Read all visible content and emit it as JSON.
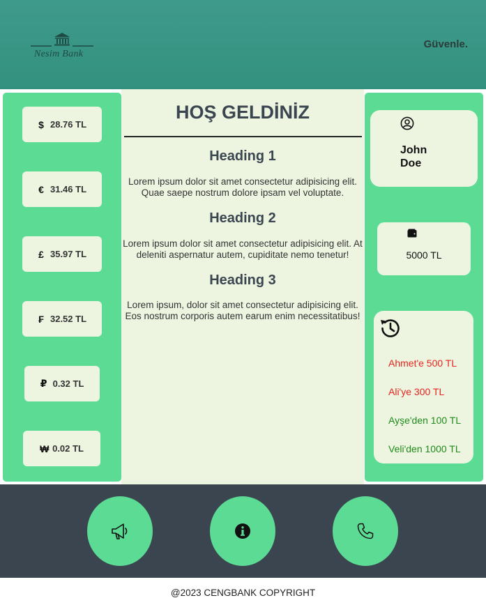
{
  "header": {
    "logo_text": "Nesim Bank",
    "tagline": "Güvenle."
  },
  "rates": [
    {
      "symbol": "$",
      "value": "28.76 TL",
      "icon": "dollar-icon"
    },
    {
      "symbol": "€",
      "value": "31.46 TL",
      "icon": "euro-icon"
    },
    {
      "symbol": "£",
      "value": "35.97 TL",
      "icon": "pound-icon"
    },
    {
      "symbol": "₣",
      "value": "32.52 TL",
      "icon": "franc-icon"
    },
    {
      "symbol": "₽",
      "value": "0.32 TL",
      "icon": "ruble-icon"
    },
    {
      "symbol": "₩",
      "value": "0.02 TL",
      "icon": "won-icon"
    }
  ],
  "content": {
    "welcome": "HOŞ GELDİNİZ",
    "sections": [
      {
        "heading": "Heading 1",
        "body": "Lorem ipsum dolor sit amet consectetur adipisicing elit. Quae saepe nostrum dolore ipsam vel voluptate."
      },
      {
        "heading": "Heading 2",
        "body": "Lorem ipsum dolor sit amet consectetur adipisicing elit. At deleniti aspernatur autem, cupiditate nemo tenetur!"
      },
      {
        "heading": "Heading 3",
        "body": "Lorem ipsum, dolor sit amet consectetur adipisicing elit. Eos nostrum corporis autem earum enim necessitatibus!"
      }
    ]
  },
  "user": {
    "name": "John Doe",
    "balance": "5000 TL"
  },
  "history": [
    {
      "text": "Ahmet'e 500 TL",
      "direction": "out",
      "color": "#e8231f"
    },
    {
      "text": "Ali'ye 300 TL",
      "direction": "out",
      "color": "#e8231f"
    },
    {
      "text": "Ayşe'den 100 TL",
      "direction": "in",
      "color": "#1f8a1a"
    },
    {
      "text": "Veli'den 1000 TL",
      "direction": "in",
      "color": "#1f8a1a"
    }
  ],
  "footer": {
    "buttons": [
      "megaphone-icon",
      "info-icon",
      "phone-icon"
    ],
    "copyright": "@2023 CENGBANK COPYRIGHT"
  },
  "colors": {
    "header": "#3a968a",
    "panel": "#5cdb95",
    "card": "#edf5e1",
    "footer": "#3b4550"
  }
}
